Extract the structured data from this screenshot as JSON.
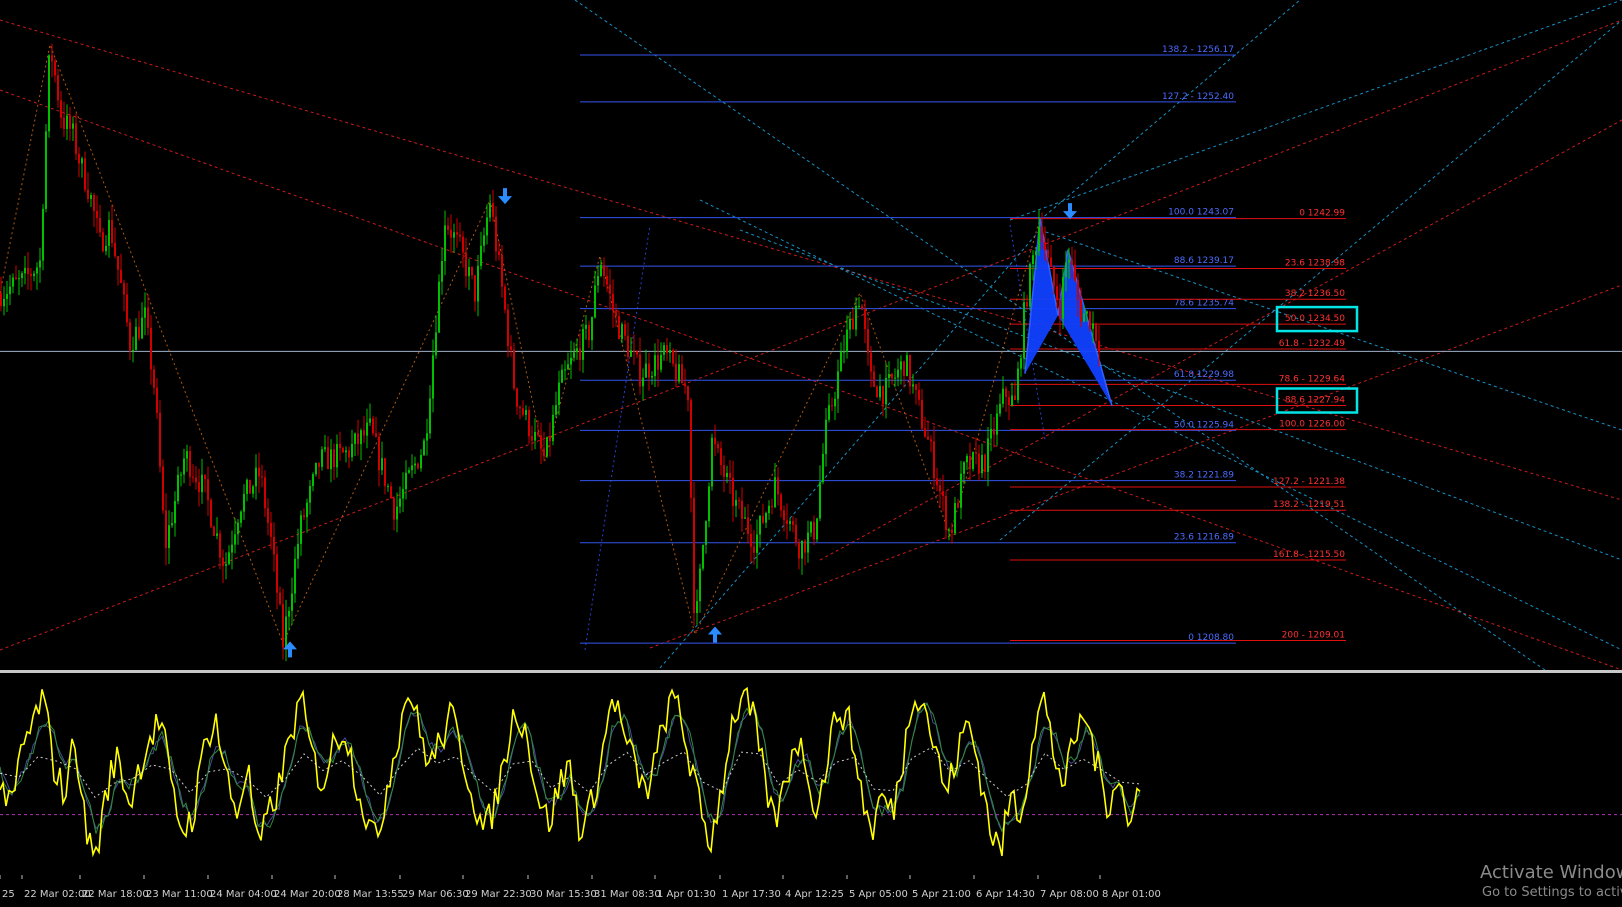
{
  "colors": {
    "background": "#000000",
    "bull_candle": "#00c000",
    "bear_candle": "#d00000",
    "fib_retracement": "#3355ee",
    "fib_projection": "#e01010",
    "channel_red": "#e02020",
    "channel_cyan": "#1aa0d8",
    "zigzag": "#b05a10",
    "pattern_fill": "#1040ff",
    "oscillator_main": "#ffff00",
    "oscillator_signal": "#2e8b3a",
    "oscillator_slow": "#4a4a9a",
    "highlight_box": "#00e5e5",
    "arrow": "#2a8cff"
  },
  "chart_data": [
    {
      "type": "candlestick",
      "symbol_hint": "price chart with Fibonacci and harmonic pattern",
      "time_labels": [
        "25",
        "22 Mar 02:00",
        "22 Mar 18:00",
        "23 Mar 11:00",
        "24 Mar 04:00",
        "24 Mar 20:00",
        "28 Mar 13:55",
        "29 Mar 06:30",
        "29 Mar 22:30",
        "30 Mar 15:30",
        "31 Mar 08:30",
        "1 Apr 01:30",
        "1 Apr 17:30",
        "4 Apr 12:25",
        "5 Apr 05:00",
        "5 Apr 21:00",
        "6 Apr 14:30",
        "7 Apr 08:00",
        "8 Apr 01:00"
      ],
      "ylim": [
        1206.8,
        1260.6
      ],
      "horizontal_line": 1232.3,
      "price_path": [
        [
          0,
          1237.0
        ],
        [
          24,
          1238.0
        ],
        [
          40,
          1239.5
        ],
        [
          50,
          1257.0
        ],
        [
          62,
          1251.0
        ],
        [
          72,
          1250.0
        ],
        [
          80,
          1247.5
        ],
        [
          90,
          1245.0
        ],
        [
          100,
          1241.0
        ],
        [
          110,
          1242.5
        ],
        [
          120,
          1238.0
        ],
        [
          130,
          1233.0
        ],
        [
          145,
          1235.0
        ],
        [
          155,
          1229.0
        ],
        [
          165,
          1216.5
        ],
        [
          185,
          1224.0
        ],
        [
          205,
          1221.0
        ],
        [
          225,
          1215.0
        ],
        [
          240,
          1220.0
        ],
        [
          260,
          1222.5
        ],
        [
          272,
          1216.5
        ],
        [
          283,
          1208.8
        ],
        [
          300,
          1218.0
        ],
        [
          320,
          1223.5
        ],
        [
          345,
          1224.0
        ],
        [
          370,
          1226.0
        ],
        [
          395,
          1219.5
        ],
        [
          425,
          1225.0
        ],
        [
          445,
          1243.0
        ],
        [
          460,
          1240.5
        ],
        [
          475,
          1237.0
        ],
        [
          490,
          1244.5
        ],
        [
          505,
          1235.5
        ],
        [
          515,
          1229.0
        ],
        [
          525,
          1227.0
        ],
        [
          545,
          1223.5
        ],
        [
          560,
          1229.5
        ],
        [
          575,
          1232.0
        ],
        [
          590,
          1234.0
        ],
        [
          600,
          1240.0
        ],
        [
          615,
          1235.0
        ],
        [
          640,
          1230.5
        ],
        [
          665,
          1232.0
        ],
        [
          688,
          1229.0
        ],
        [
          695,
          1209.5
        ],
        [
          712,
          1225.0
        ],
        [
          735,
          1220.0
        ],
        [
          755,
          1217.0
        ],
        [
          775,
          1221.5
        ],
        [
          800,
          1216.5
        ],
        [
          815,
          1218.0
        ],
        [
          825,
          1225.5
        ],
        [
          845,
          1233.0
        ],
        [
          860,
          1237.0
        ],
        [
          870,
          1230.0
        ],
        [
          885,
          1229.0
        ],
        [
          905,
          1231.5
        ],
        [
          930,
          1224.5
        ],
        [
          950,
          1217.5
        ],
        [
          965,
          1223.0
        ],
        [
          985,
          1223.5
        ],
        [
          1005,
          1229.0
        ],
        [
          1015,
          1228.0
        ],
        [
          1025,
          1236.0
        ],
        [
          1040,
          1243.0
        ],
        [
          1050,
          1238.5
        ],
        [
          1060,
          1236.0
        ],
        [
          1068,
          1240.5
        ],
        [
          1080,
          1235.5
        ],
        [
          1090,
          1235.0
        ],
        [
          1100,
          1233.0
        ]
      ],
      "swing_arrows": [
        {
          "direction": "up",
          "price": 1208.3,
          "bar_hint": "24 Mar 20:00"
        },
        {
          "direction": "down",
          "price": 1244.8,
          "bar_hint": "29 Mar 22:30"
        },
        {
          "direction": "up",
          "price": 1209.5,
          "bar_hint": "1 Apr 17:30"
        },
        {
          "direction": "down",
          "price": 1243.6,
          "bar_hint": "7 Apr 08:00"
        }
      ],
      "fib_retracement_levels": [
        {
          "label": "138.2 - 1256.17",
          "price": 1256.17
        },
        {
          "label": "127.2 - 1252.40",
          "price": 1252.4
        },
        {
          "label": "100.0 1243.07",
          "price": 1243.07
        },
        {
          "label": "88.6 1239.17",
          "price": 1239.17
        },
        {
          "label": "78.6 1235.74",
          "price": 1235.74
        },
        {
          "label": "61.8 1229.98",
          "price": 1229.98
        },
        {
          "label": "50.0 1225.94",
          "price": 1225.94
        },
        {
          "label": "38.2 1221.89",
          "price": 1221.89
        },
        {
          "label": "23.6 1216.89",
          "price": 1216.89
        },
        {
          "label": "0 1208.80",
          "price": 1208.8
        }
      ],
      "fib_projection_levels": [
        {
          "label": "0 1242.99",
          "price": 1242.99,
          "highlighted": false
        },
        {
          "label": "23.6 1238.98",
          "price": 1238.98,
          "highlighted": false
        },
        {
          "label": "38.2 1236.50",
          "price": 1236.5,
          "highlighted": false
        },
        {
          "label": "50.0 1234.50",
          "price": 1234.5,
          "highlighted": true
        },
        {
          "label": "61.8 - 1232.49",
          "price": 1232.49,
          "highlighted": false
        },
        {
          "label": "78.6 - 1229.64",
          "price": 1229.64,
          "highlighted": false
        },
        {
          "label": "88.6 1227.94",
          "price": 1227.94,
          "highlighted": true
        },
        {
          "label": "100.0 1226.00",
          "price": 1226.0,
          "highlighted": false
        },
        {
          "label": "127.2 - 1221.38",
          "price": 1221.38,
          "highlighted": false
        },
        {
          "label": "138.2 - 1219.51",
          "price": 1219.51,
          "highlighted": false
        },
        {
          "label": "161.8 - 1215.50",
          "price": 1215.5,
          "highlighted": false
        },
        {
          "label": "200 - 1209.01",
          "price": 1209.01,
          "highlighted": false
        }
      ]
    },
    {
      "type": "line",
      "role": "oscillator",
      "series": [
        {
          "values": [
            50,
            30,
            62,
            75,
            90,
            55,
            40,
            70,
            20,
            10,
            45,
            60,
            35,
            55,
            70,
            78,
            40,
            22,
            30,
            65,
            80,
            50,
            30,
            55,
            12,
            30,
            45,
            70,
            88,
            60,
            45,
            65,
            75,
            50,
            30,
            15,
            45,
            70,
            95,
            72,
            55,
            68,
            80,
            60,
            40,
            20,
            35,
            60,
            85,
            70,
            40,
            25,
            45,
            55,
            20,
            35,
            60,
            92,
            70,
            55,
            40,
            58,
            82,
            88,
            60,
            35,
            15,
            40,
            75,
            90,
            80,
            50,
            25,
            45,
            70,
            55,
            30,
            62,
            85,
            75,
            45,
            20,
            40,
            30,
            60,
            95,
            85,
            62,
            40,
            60,
            78,
            55,
            25,
            10,
            40,
            30,
            70,
            90,
            60,
            45,
            70,
            80,
            55,
            35,
            52,
            20,
            48
          ]
        },
        {
          "values": [
            52,
            40,
            50,
            62,
            78,
            70,
            55,
            58,
            40,
            22,
            30,
            48,
            45,
            48,
            60,
            70,
            55,
            35,
            28,
            45,
            65,
            60,
            45,
            45,
            25,
            25,
            35,
            55,
            75,
            70,
            55,
            58,
            68,
            60,
            42,
            25,
            32,
            55,
            80,
            80,
            65,
            62,
            72,
            68,
            52,
            32,
            30,
            45,
            70,
            75,
            55,
            35,
            38,
            48,
            32,
            30,
            45,
            75,
            80,
            65,
            50,
            50,
            68,
            82,
            72,
            50,
            28,
            28,
            55,
            78,
            85,
            68,
            40,
            38,
            55,
            60,
            42,
            48,
            70,
            78,
            62,
            35,
            32,
            32,
            45,
            75,
            88,
            75,
            55,
            52,
            66,
            65,
            42,
            22,
            28,
            32,
            50,
            75,
            72,
            55,
            58,
            72,
            65,
            45,
            45,
            32,
            40
          ]
        }
      ],
      "ylim": [
        0,
        100
      ],
      "reference_level": 30
    }
  ],
  "watermark": {
    "line1": "Activate Windows",
    "line2": "Go to Settings to activate Windows."
  }
}
